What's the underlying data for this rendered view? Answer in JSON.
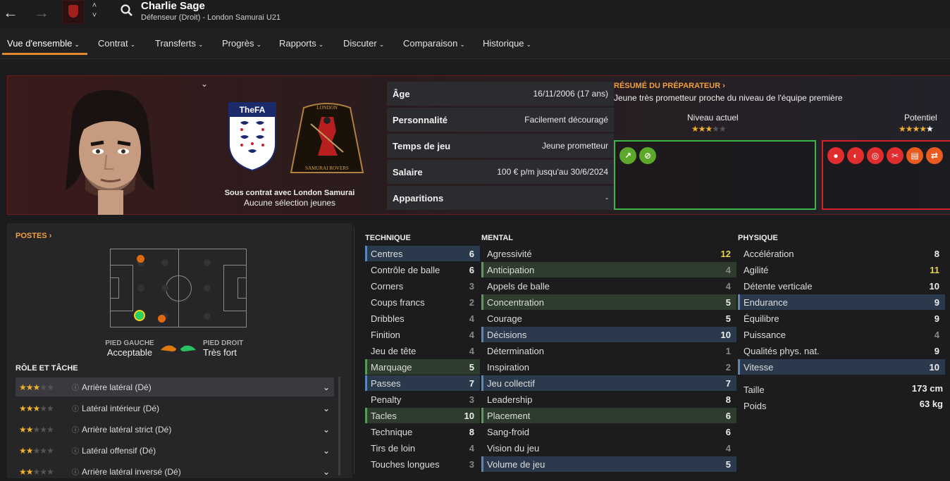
{
  "topbar": {
    "back": "←",
    "forward": "→",
    "up": "˄",
    "down": "˅",
    "player_name": "Charlie Sage",
    "player_sub": "Défenseur (Droit) - London Samurai U21"
  },
  "tabs": [
    "Vue d'ensemble",
    "Contrat",
    "Transferts",
    "Progrès",
    "Rapports",
    "Discuter",
    "Comparaison",
    "Historique"
  ],
  "tab_chevron": "⌄",
  "header": {
    "collapse": "⌄",
    "fa_text": "TheFA",
    "club_top": "LONDON",
    "club_bottom": "SAMURAI ROVERS",
    "contract_line1": "Sous contrat avec London Samurai",
    "contract_line2": "Aucune sélection jeunes",
    "info": [
      {
        "k": "Âge",
        "v": "16/11/2006 (17 ans)"
      },
      {
        "k": "Personnalité",
        "v": "Facilement découragé"
      },
      {
        "k": "Temps de jeu",
        "v": "Jeune prometteur"
      },
      {
        "k": "Salaire",
        "v": "100 € p/m jusqu'au 30/6/2024"
      },
      {
        "k": "Apparitions",
        "v": "-"
      }
    ],
    "coach_title": "RÉSUMÉ DU PRÉPARATEUR ›",
    "coach_text": "Jeune très prometteur proche du niveau de l'équipe première",
    "niveau_label": "Niveau actuel",
    "potentiel_label": "Potentiel",
    "niveau_stars": "★★★",
    "niveau_stars_off": "★★",
    "potentiel_stars": "★★★★",
    "potentiel_stars_off": "★",
    "niveau_value": 3,
    "potentiel_value": 4.5
  },
  "left": {
    "postes": "POSTES ›",
    "pied_gauche_t": "PIED GAUCHE",
    "pied_gauche_v": "Acceptable",
    "pied_droit_t": "PIED DROIT",
    "pied_droit_v": "Très fort",
    "role_title": "RÔLE ET TÂCHE",
    "info_icon": "ⓘ",
    "dropdown": "⌄",
    "roles": [
      {
        "stars": "★★★",
        "off": "★★",
        "label": "Arrière latéral (Dé)"
      },
      {
        "stars": "★★★",
        "off": "★★",
        "label": "Latéral intérieur (Dé)"
      },
      {
        "stars": "★★",
        "off": "★★★",
        "label": "Arrière latéral strict (Dé)"
      },
      {
        "stars": "★★",
        "off": "★★★",
        "label": "Latéral offensif (Dé)"
      },
      {
        "stars": "★★",
        "off": "★★★",
        "label": "Arrière latéral inversé (Dé)"
      }
    ]
  },
  "attributes": {
    "technique_title": "TECHNIQUE",
    "mental_title": "MENTAL",
    "physique_title": "PHYSIQUE",
    "technique": [
      [
        "Centres",
        "6"
      ],
      [
        "Contrôle de balle",
        "6"
      ],
      [
        "Corners",
        "3"
      ],
      [
        "Coups francs",
        "2"
      ],
      [
        "Dribbles",
        "4"
      ],
      [
        "Finition",
        "4"
      ],
      [
        "Jeu de tête",
        "4"
      ],
      [
        "Marquage",
        "5"
      ],
      [
        "Passes",
        "7"
      ],
      [
        "Penalty",
        "3"
      ],
      [
        "Tacles",
        "10"
      ],
      [
        "Technique",
        "8"
      ],
      [
        "Tirs de loin",
        "4"
      ],
      [
        "Touches longues",
        "3"
      ]
    ],
    "mental": [
      [
        "Agressivité",
        "12"
      ],
      [
        "Anticipation",
        "4"
      ],
      [
        "Appels de balle",
        "4"
      ],
      [
        "Concentration",
        "5"
      ],
      [
        "Courage",
        "5"
      ],
      [
        "Décisions",
        "10"
      ],
      [
        "Détermination",
        "1"
      ],
      [
        "Inspiration",
        "2"
      ],
      [
        "Jeu collectif",
        "7"
      ],
      [
        "Leadership",
        "8"
      ],
      [
        "Placement",
        "6"
      ],
      [
        "Sang-froid",
        "6"
      ],
      [
        "Vision du jeu",
        "4"
      ],
      [
        "Volume de jeu",
        "5"
      ]
    ],
    "physique": [
      [
        "Accélération",
        "8"
      ],
      [
        "Agilité",
        "11"
      ],
      [
        "Détente verticale",
        "10"
      ],
      [
        "Endurance",
        "9"
      ],
      [
        "Équilibre",
        "9"
      ],
      [
        "Puissance",
        "4"
      ],
      [
        "Qualités phys. nat.",
        "9"
      ],
      [
        "Vitesse",
        "10"
      ]
    ],
    "taille_label": "Taille",
    "taille": "173 cm",
    "poids_label": "Poids",
    "poids": "63 kg"
  }
}
